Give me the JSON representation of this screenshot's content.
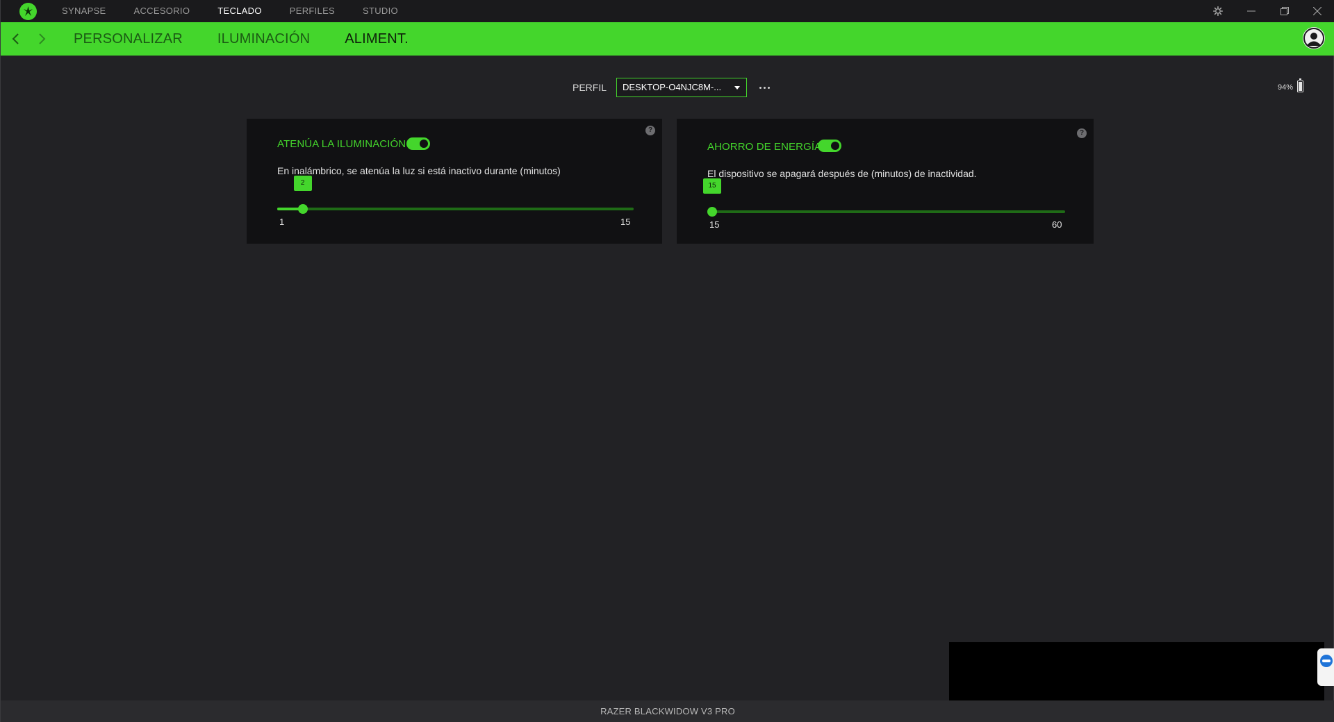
{
  "titlebar": {
    "logo_icon": "razer-logo-icon",
    "tabs": [
      {
        "label": "SYNAPSE"
      },
      {
        "label": "ACCESORIO"
      },
      {
        "label": "TECLADO",
        "active": true
      },
      {
        "label": "PERFILES"
      },
      {
        "label": "STUDIO"
      }
    ],
    "controls": [
      "settings-icon",
      "minimize-icon",
      "restore-icon",
      "close-icon"
    ]
  },
  "subnav": {
    "tabs": [
      {
        "label": "PERSONALIZAR"
      },
      {
        "label": "ILUMINACIÓN"
      },
      {
        "label": "ALIMENT.",
        "active": true
      }
    ]
  },
  "profile": {
    "label": "PERFIL",
    "selected": "DESKTOP-O4NJC8M-..."
  },
  "battery": {
    "percent_text": "94%",
    "level": 0.94
  },
  "cards": {
    "dim": {
      "title": "ATENÚA LA ILUMINACIÓN",
      "enabled": true,
      "description": "En inalámbrico, se atenúa la luz si está inactivo durante (minutos)",
      "min": "1",
      "max": "15",
      "value": "2",
      "value_fraction": 0.0714
    },
    "power": {
      "title": "AHORRO DE ENERGÍA",
      "enabled": true,
      "description": "El dispositivo se apagará después de (minutos) de inactividad.",
      "min": "15",
      "max": "60",
      "value": "15",
      "value_fraction": 0.0
    }
  },
  "footer": {
    "device_name": "RAZER BLACKWIDOW V3 PRO"
  },
  "colors": {
    "accent": "#44d62c",
    "background": "#222225",
    "card": "#111113"
  }
}
